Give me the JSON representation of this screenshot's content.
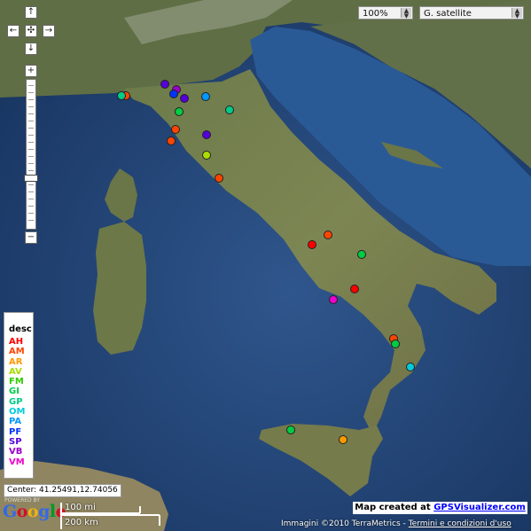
{
  "controls": {
    "zoom_select": "100%",
    "maptype_select": "G. satellite",
    "pan_up": "↑",
    "pan_left": "←",
    "pan_center": "✣",
    "pan_right": "→",
    "pan_down": "↓",
    "zoom_in": "+",
    "zoom_out": "−"
  },
  "legend": {
    "title": "desc",
    "items": [
      {
        "label": "AH",
        "color": "#ff0000"
      },
      {
        "label": "AM",
        "color": "#ff4400"
      },
      {
        "label": "AR",
        "color": "#ff9900"
      },
      {
        "label": "AV",
        "color": "#aadd00"
      },
      {
        "label": "FM",
        "color": "#33cc00"
      },
      {
        "label": "GI",
        "color": "#00cc44"
      },
      {
        "label": "GP",
        "color": "#00cc88"
      },
      {
        "label": "OM",
        "color": "#00ccdd"
      },
      {
        "label": "PA",
        "color": "#0099ff"
      },
      {
        "label": "PF",
        "color": "#0033ff"
      },
      {
        "label": "SP",
        "color": "#5500dd"
      },
      {
        "label": "VB",
        "color": "#9900cc"
      },
      {
        "label": "VM",
        "color": "#ee00cc"
      }
    ]
  },
  "markers": [
    {
      "category": "AM"
    },
    {
      "category": "GP"
    },
    {
      "category": "SP"
    },
    {
      "category": "VB"
    },
    {
      "category": "PF"
    },
    {
      "category": "SP"
    },
    {
      "category": "PA"
    },
    {
      "category": "GI"
    },
    {
      "category": "GP"
    },
    {
      "category": "AM"
    },
    {
      "category": "AM"
    },
    {
      "category": "SP"
    },
    {
      "category": "AV"
    },
    {
      "category": "AM"
    },
    {
      "category": "AH"
    },
    {
      "category": "AM"
    },
    {
      "category": "GI"
    },
    {
      "category": "AH"
    },
    {
      "category": "VM"
    },
    {
      "category": "AM"
    },
    {
      "category": "GI"
    },
    {
      "category": "OM"
    },
    {
      "category": "GI"
    },
    {
      "category": "AR"
    }
  ],
  "center_readout": "Center: 41.25491,12.74056",
  "google_logo": "Google",
  "powered_by": "POWERED BY",
  "scale": {
    "mi": "100 mi",
    "km": "200 km"
  },
  "map_created": {
    "prefix": "Map created at",
    "link": "GPSVisualizer.com"
  },
  "attribution": {
    "text": "Immagini ©2010 TerraMetrics -",
    "link": "Termini e condizioni d'uso"
  }
}
